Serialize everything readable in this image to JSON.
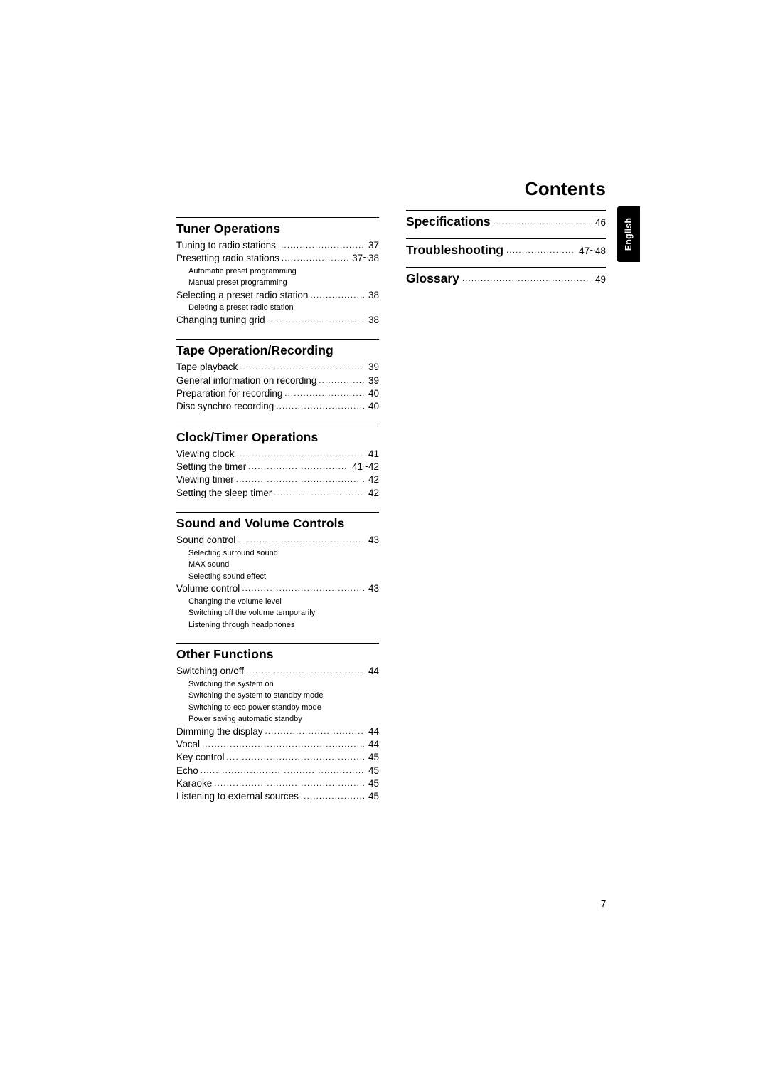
{
  "page": {
    "title": "Contents",
    "page_number": "7",
    "side_tab": "English"
  },
  "left_column": [
    {
      "heading": "Tuner Operations",
      "entries": [
        {
          "type": "entry",
          "text": "Tuning to radio stations",
          "page": "37"
        },
        {
          "type": "entry",
          "text": "Presetting radio stations",
          "page": "37~38"
        },
        {
          "type": "sub",
          "text": "Automatic preset programming"
        },
        {
          "type": "sub",
          "text": "Manual preset programming"
        },
        {
          "type": "entry",
          "text": "Selecting a preset radio station",
          "page": "38"
        },
        {
          "type": "sub",
          "text": "Deleting a preset radio station"
        },
        {
          "type": "entry",
          "text": "Changing tuning grid",
          "page": "38"
        }
      ]
    },
    {
      "heading": "Tape Operation/Recording",
      "entries": [
        {
          "type": "entry",
          "text": "Tape playback",
          "page": "39"
        },
        {
          "type": "entry",
          "text": "General information on recording",
          "page": "39"
        },
        {
          "type": "entry",
          "text": "Preparation for recording",
          "page": "40"
        },
        {
          "type": "entry",
          "text": "Disc synchro recording",
          "page": "40"
        }
      ]
    },
    {
      "heading": "Clock/Timer Operations",
      "entries": [
        {
          "type": "entry",
          "text": "Viewing clock",
          "page": "41"
        },
        {
          "type": "entry",
          "text": "Setting the timer",
          "page": "41~42"
        },
        {
          "type": "entry",
          "text": "Viewing timer",
          "page": "42"
        },
        {
          "type": "entry",
          "text": "Setting the sleep timer",
          "page": "42"
        }
      ]
    },
    {
      "heading": "Sound and Volume Controls",
      "entries": [
        {
          "type": "entry",
          "text": "Sound control",
          "page": "43"
        },
        {
          "type": "sub",
          "text": "Selecting surround sound"
        },
        {
          "type": "sub",
          "text": "MAX sound"
        },
        {
          "type": "sub",
          "text": "Selecting sound effect"
        },
        {
          "type": "entry",
          "text": "Volume control",
          "page": "43"
        },
        {
          "type": "sub",
          "text": "Changing the volume level"
        },
        {
          "type": "sub",
          "text": "Switching off the volume temporarily"
        },
        {
          "type": "sub",
          "text": "Listening through headphones"
        }
      ]
    },
    {
      "heading": "Other Functions",
      "entries": [
        {
          "type": "entry",
          "text": "Switching on/off",
          "page": "44"
        },
        {
          "type": "sub",
          "text": "Switching the system on"
        },
        {
          "type": "sub",
          "text": "Switching the system to standby mode"
        },
        {
          "type": "sub",
          "text": "Switching to eco power standby mode"
        },
        {
          "type": "sub",
          "text": "Power saving automatic standby"
        },
        {
          "type": "entry",
          "text": "Dimming the display",
          "page": "44"
        },
        {
          "type": "entry",
          "text": "Vocal",
          "page": "44"
        },
        {
          "type": "entry",
          "text": "Key control",
          "page": "45"
        },
        {
          "type": "entry",
          "text": "Echo",
          "page": "45"
        },
        {
          "type": "entry",
          "text": "Karaoke",
          "page": "45"
        },
        {
          "type": "entry",
          "text": "Listening to external sources",
          "page": "45"
        }
      ]
    }
  ],
  "right_column": [
    {
      "text": "Specifications",
      "page": "46"
    },
    {
      "text": "Troubleshooting",
      "page": "47~48"
    },
    {
      "text": "Glossary",
      "page": "49"
    }
  ]
}
